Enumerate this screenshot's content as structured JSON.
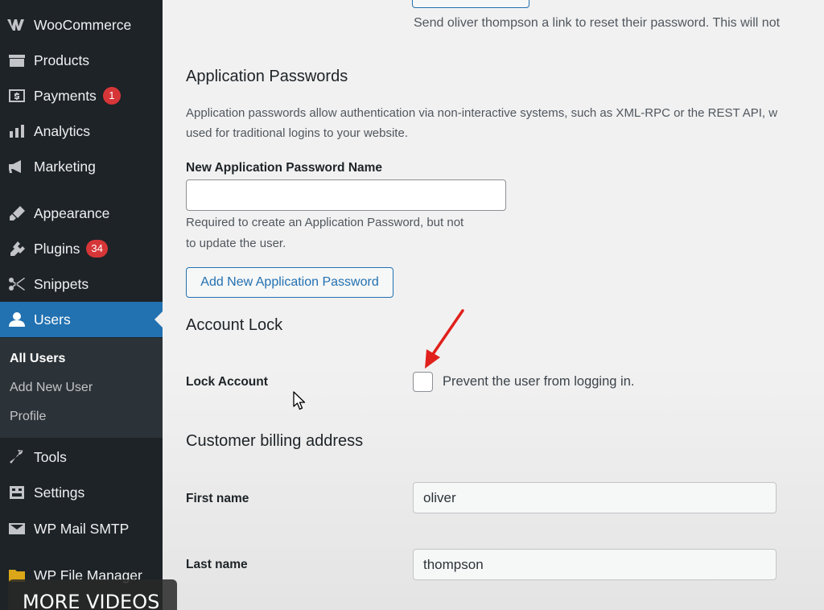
{
  "sidebar": {
    "menu": [
      {
        "icon": "woocommerce-icon",
        "label": "WooCommerce"
      },
      {
        "icon": "products-icon",
        "label": "Products"
      },
      {
        "icon": "payments-icon",
        "label": "Payments",
        "badge": "1"
      },
      {
        "icon": "analytics-icon",
        "label": "Analytics"
      },
      {
        "icon": "marketing-icon",
        "label": "Marketing"
      },
      {
        "icon": "appearance-icon",
        "label": "Appearance"
      },
      {
        "icon": "plugins-icon",
        "label": "Plugins",
        "badge": "34"
      },
      {
        "icon": "snippets-icon",
        "label": "Snippets"
      },
      {
        "icon": "users-icon",
        "label": "Users"
      },
      {
        "icon": "tools-icon",
        "label": "Tools"
      },
      {
        "icon": "settings-icon",
        "label": "Settings"
      },
      {
        "icon": "mail-icon",
        "label": "WP Mail SMTP"
      },
      {
        "icon": "folder-icon",
        "label": "WP File Manager"
      }
    ],
    "submenu": [
      "All Users",
      "Add New User",
      "Profile"
    ]
  },
  "overlay": {
    "more_videos": "MORE VIDEOS"
  },
  "main": {
    "reset_desc": "Send oliver thompson a link to reset their password. This will not",
    "app_passwords": {
      "title": "Application Passwords",
      "desc_line1": "Application passwords allow authentication via non-interactive systems, such as XML-RPC or the REST API, w",
      "desc_line2": "used for traditional logins to your website.",
      "field_label": "New Application Password Name",
      "field_value": "",
      "help_line1": "Required to create an Application Password, but not",
      "help_line2": "to update the user.",
      "add_button": "Add New Application Password"
    },
    "account_lock": {
      "title": "Account Lock",
      "label": "Lock Account",
      "checkbox_label": "Prevent the user from logging in.",
      "checked": false
    },
    "billing": {
      "title": "Customer billing address",
      "first_name_label": "First name",
      "first_name_value": "oliver",
      "last_name_label": "Last name",
      "last_name_value": "thompson"
    }
  },
  "colors": {
    "sidebar_bg": "#1d2327",
    "accent": "#2271b1",
    "badge": "#d63638",
    "annotation_arrow": "#e0201b"
  }
}
